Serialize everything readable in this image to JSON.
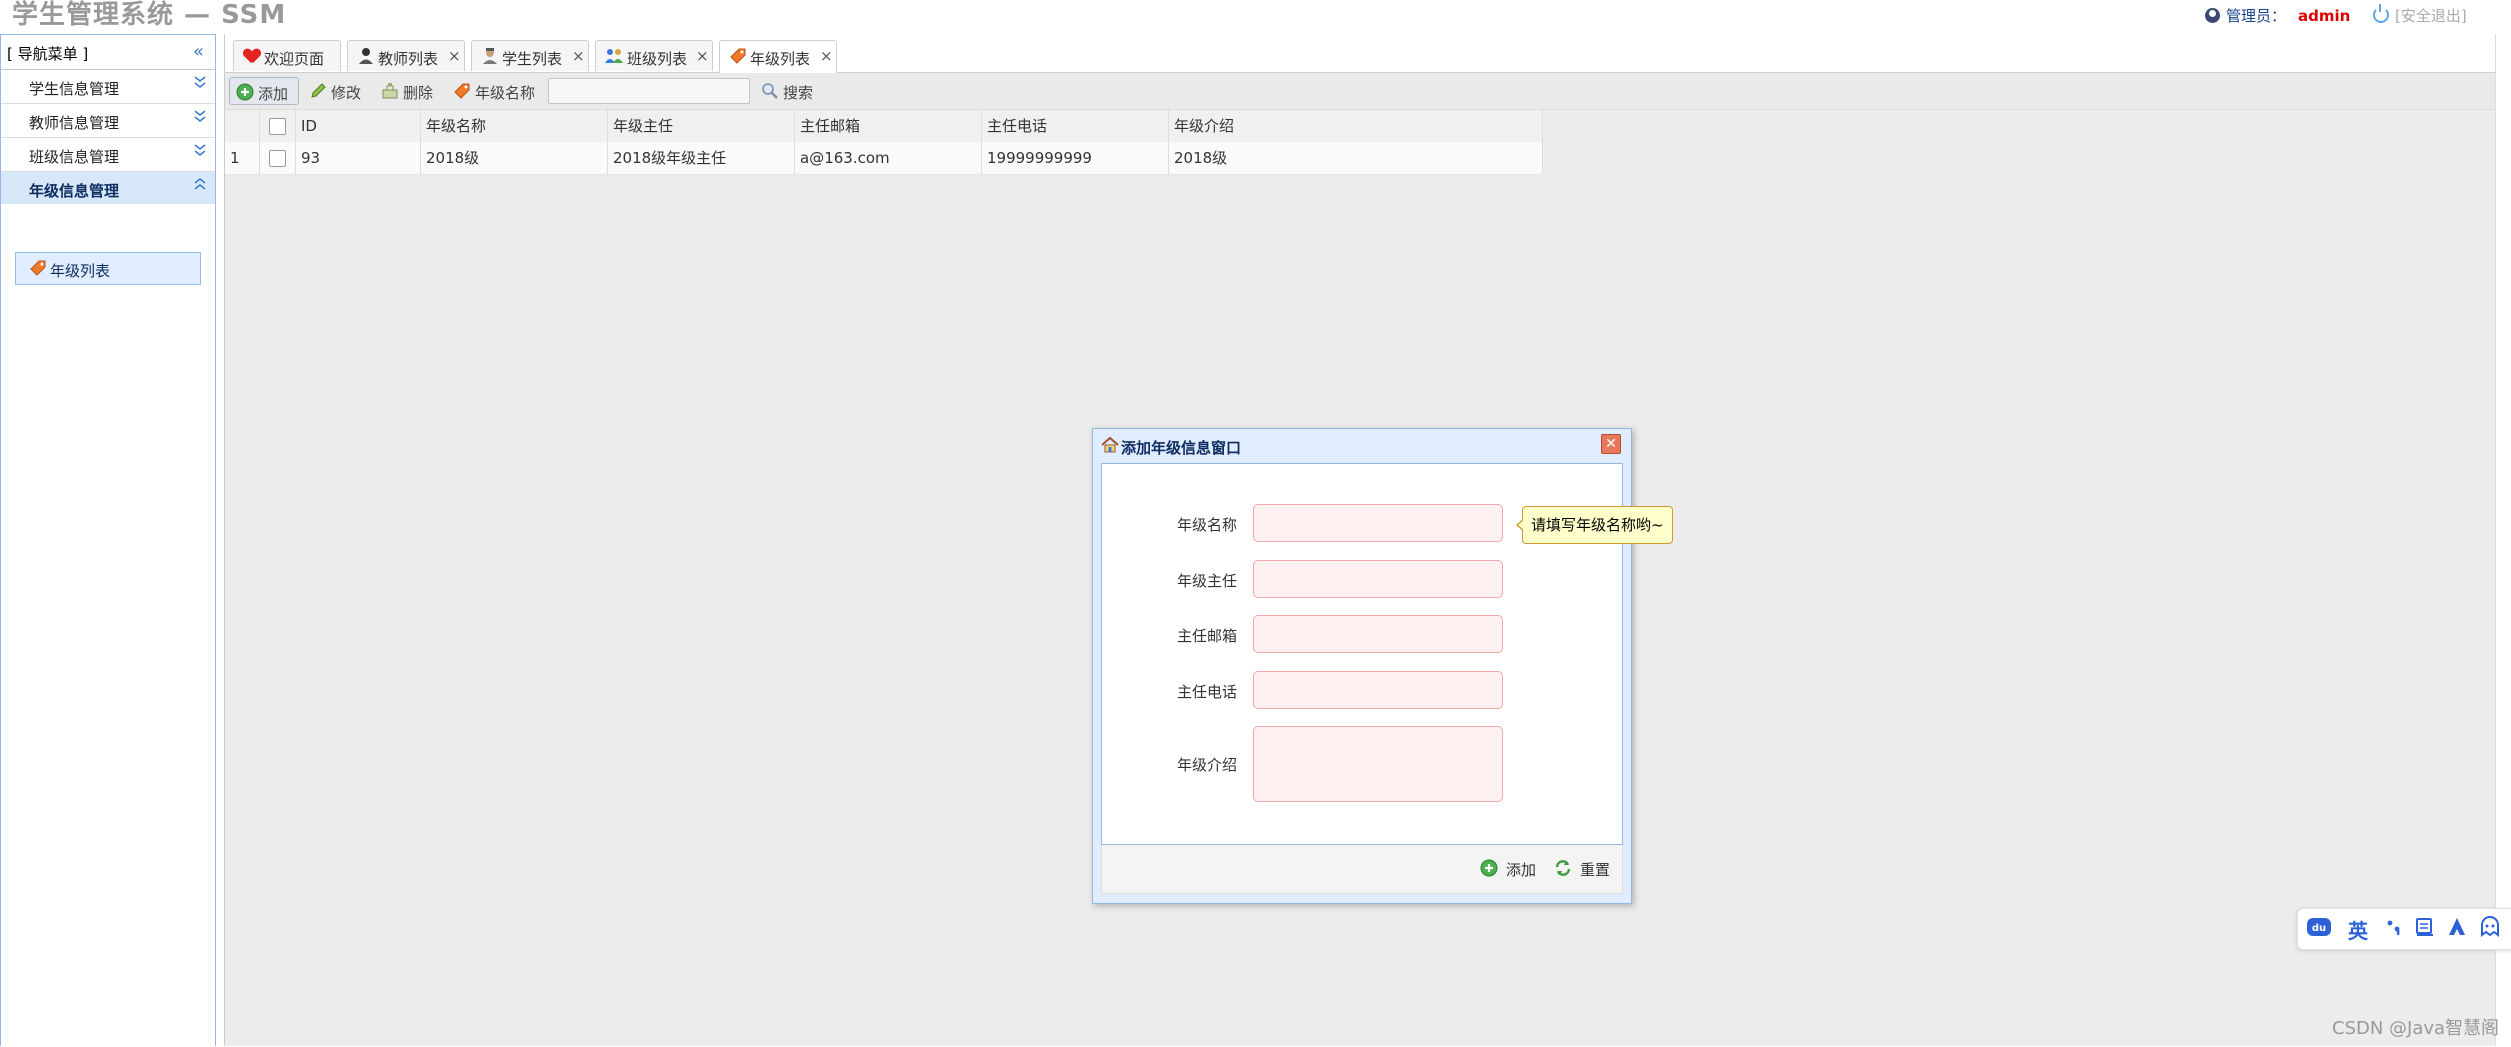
{
  "header": {
    "app_title": "学生管理系统 — SSM",
    "admin_label": "管理员：",
    "admin_name": "admin",
    "logout_label": "[安全退出]"
  },
  "sidebar": {
    "title": "[ 导航菜单 ]",
    "collapse_icon": "double-chevron-left",
    "sections": [
      {
        "label": "学生信息管理",
        "expanded": false
      },
      {
        "label": "教师信息管理",
        "expanded": false
      },
      {
        "label": "班级信息管理",
        "expanded": false
      },
      {
        "label": "年级信息管理",
        "expanded": true
      }
    ],
    "active_item": "年级列表"
  },
  "tabs": [
    {
      "label": "欢迎页面",
      "icon": "heart-icon",
      "closable": false
    },
    {
      "label": "教师列表",
      "icon": "teacher-icon",
      "closable": true
    },
    {
      "label": "学生列表",
      "icon": "student-icon",
      "closable": true
    },
    {
      "label": "班级列表",
      "icon": "class-icon",
      "closable": true
    },
    {
      "label": "年级列表",
      "icon": "tag-icon",
      "closable": true,
      "selected": true
    }
  ],
  "toolbar": {
    "add": "添加",
    "edit": "修改",
    "delete": "删除",
    "filter_label": "年级名称",
    "search_value": "",
    "search": "搜索"
  },
  "grid": {
    "columns": [
      "ID",
      "年级名称",
      "年级主任",
      "主任邮箱",
      "主任电话",
      "年级介绍"
    ],
    "rows": [
      {
        "num": "1",
        "id": "93",
        "name": "2018级",
        "director": "2018级年级主任",
        "email": "a@163.com",
        "phone": "19999999999",
        "intro": "2018级"
      }
    ]
  },
  "dialog": {
    "title": "添加年级信息窗口",
    "fields": {
      "name": {
        "label": "年级名称",
        "value": ""
      },
      "director": {
        "label": "年级主任",
        "value": ""
      },
      "email": {
        "label": "主任邮箱",
        "value": ""
      },
      "phone": {
        "label": "主任电话",
        "value": ""
      },
      "intro": {
        "label": "年级介绍",
        "value": ""
      }
    },
    "tooltip": "请填写年级名称哟~",
    "add_button": "添加",
    "reset_button": "重置"
  },
  "ime": {
    "mode": "英"
  },
  "watermark": "CSDN @Java智慧阁",
  "colors": {
    "accent": "#3d7ac7",
    "admin_name": "#dd0000",
    "active_nav_bg": "#d7e8fb",
    "invalid_field_bg": "#fff1f1",
    "invalid_field_border": "#f0a8a8",
    "tooltip_bg": "#ffffcc"
  }
}
